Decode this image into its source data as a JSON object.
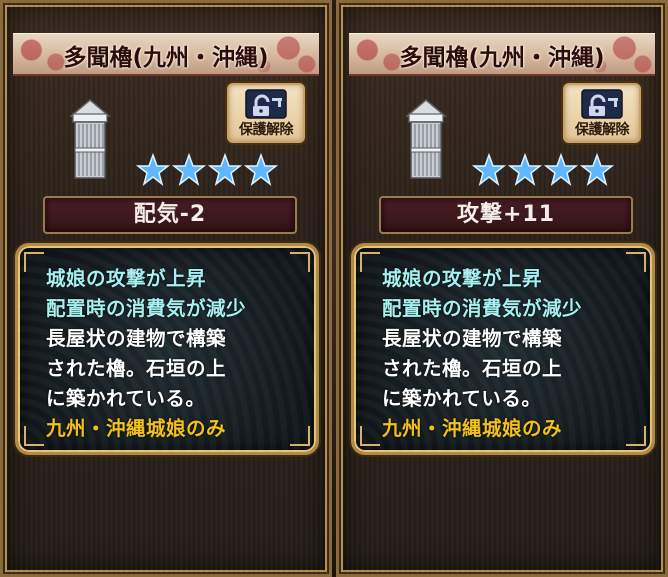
{
  "cards": [
    {
      "title": "多聞櫓(九州・沖縄)",
      "unlock_label": "保護解除",
      "rarity_stars": 4,
      "stat": "配気-2",
      "description": {
        "skill_lines": [
          "城娘の攻撃が上昇",
          "配置時の消費気が減少"
        ],
        "lore_lines": [
          "長屋状の建物で構築",
          "された櫓。石垣の上",
          "に築かれている。"
        ],
        "restriction": "九州・沖縄城娘のみ"
      }
    },
    {
      "title": "多聞櫓(九州・沖縄)",
      "unlock_label": "保護解除",
      "rarity_stars": 4,
      "stat": "攻撃+11",
      "description": {
        "skill_lines": [
          "城娘の攻撃が上昇",
          "配置時の消費気が減少"
        ],
        "lore_lines": [
          "長屋状の建物で構築",
          "された櫓。石垣の上",
          "に築かれている。"
        ],
        "restriction": "九州・沖縄城娘のみ"
      }
    }
  ],
  "icons": {
    "item_icon": "tower-icon",
    "unlock_icon": "lock-icon",
    "rarity_icon": "star-icon"
  },
  "colors": {
    "skill_text": "#a7f0f2",
    "lore_text": "#ffffff",
    "restriction_text": "#f2c21a",
    "star": "#5fb8ff",
    "frame_gold": "#b28a48"
  }
}
